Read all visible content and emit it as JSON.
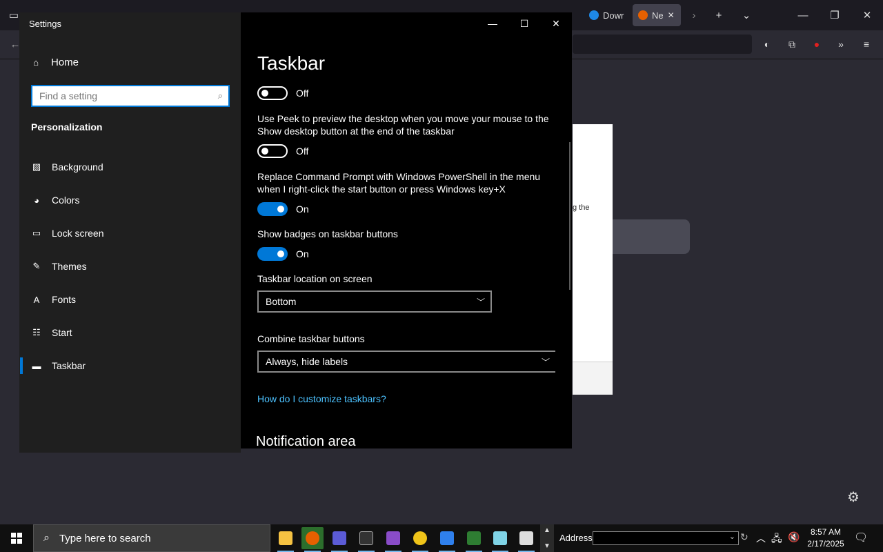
{
  "browser": {
    "tabs": [
      {
        "label": "Dowr",
        "favicon_color": "#1e88e5"
      },
      {
        "label": "Ne",
        "favicon_color": "#e66000"
      }
    ],
    "background_text": "g the"
  },
  "settings": {
    "window_title": "Settings",
    "home_label": "Home",
    "search_placeholder": "Find a setting",
    "section_label": "Personalization",
    "nav_items": [
      {
        "label": "Background",
        "icon": "image-icon"
      },
      {
        "label": "Colors",
        "icon": "palette-icon"
      },
      {
        "label": "Lock screen",
        "icon": "lock-screen-icon"
      },
      {
        "label": "Themes",
        "icon": "brush-icon"
      },
      {
        "label": "Fonts",
        "icon": "font-icon"
      },
      {
        "label": "Start",
        "icon": "start-icon"
      },
      {
        "label": "Taskbar",
        "icon": "taskbar-icon",
        "selected": true
      }
    ],
    "page_title": "Taskbar",
    "toggle_top_state": "Off",
    "peek_desc": "Use Peek to preview the desktop when you move your mouse to the Show desktop button at the end of the taskbar",
    "peek_state": "Off",
    "powershell_desc": "Replace Command Prompt with Windows PowerShell in the menu when I right-click the start button or press Windows key+X",
    "powershell_state": "On",
    "badges_desc": "Show badges on taskbar buttons",
    "badges_state": "On",
    "location_label": "Taskbar location on screen",
    "location_value": "Bottom",
    "combine_label": "Combine taskbar buttons",
    "combine_value": "Always, hide labels",
    "help_link": "How do I customize taskbars?",
    "notification_heading": "Notification area",
    "accent_color": "#0078d7"
  },
  "taskbar": {
    "search_placeholder": "Type here to search",
    "address_label": "Address",
    "time": "8:57 AM",
    "date": "2/17/2025",
    "apps": [
      {
        "name": "file-explorer-icon",
        "color": "#f5c242"
      },
      {
        "name": "firefox-icon",
        "color": "#e66000",
        "active": true
      },
      {
        "name": "app-b-icon",
        "color": "#5b5bd6"
      },
      {
        "name": "terminal-icon",
        "color": "#333333"
      },
      {
        "name": "archive-icon",
        "color": "#8a4cc8"
      },
      {
        "name": "app-smile-icon",
        "color": "#f0c419"
      },
      {
        "name": "app-bird-icon",
        "color": "#2f80ed"
      },
      {
        "name": "app-grid-icon",
        "color": "#2e7d32"
      },
      {
        "name": "app-notepad-icon",
        "color": "#7fd3e6"
      },
      {
        "name": "download-icon",
        "color": "#dddddd"
      }
    ]
  }
}
